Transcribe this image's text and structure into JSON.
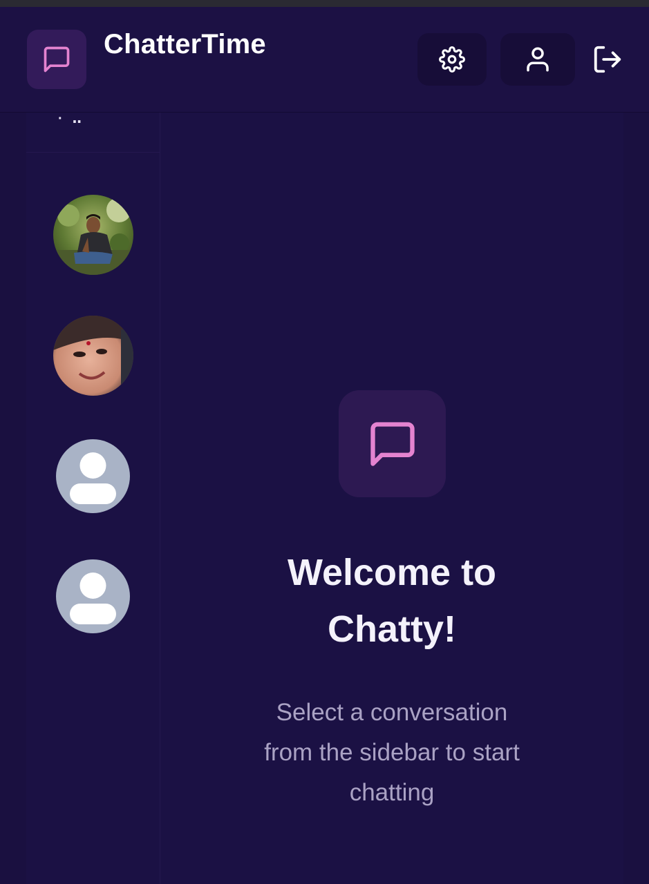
{
  "app": {
    "title": "ChatterTime",
    "accent_color": "#e483d0",
    "background_color": "#1b1144"
  },
  "navbar": {
    "logo_icon": "message-square-icon",
    "settings_icon": "gear-icon",
    "profile_icon": "user-icon",
    "logout_icon": "logout-icon"
  },
  "sidebar": {
    "contacts": [
      {
        "avatar": "photo-man"
      },
      {
        "avatar": "photo-woman"
      },
      {
        "avatar": "default-user-icon"
      },
      {
        "avatar": "default-user-icon"
      }
    ]
  },
  "welcome": {
    "icon": "message-square-icon",
    "title": "Welcome to Chatty!",
    "subtitle": "Select a conversation from the sidebar to start chatting"
  }
}
